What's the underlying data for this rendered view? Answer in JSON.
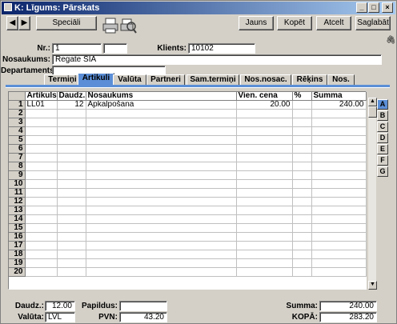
{
  "window": {
    "title": "K: Līgums: Pārskats"
  },
  "toolbar": {
    "special_label": "Speciāli",
    "new_label": "Jauns",
    "copy_label": "Kopēt",
    "cancel_label": "Atcelt",
    "save_label": "Saglabāt"
  },
  "header": {
    "nr_label": "Nr.:",
    "nr_value": "1",
    "client_label": "Klients:",
    "client_value": "10102",
    "name_label": "Nosaukums:",
    "name_value": "Regate SIA",
    "dept_label": "Departaments:",
    "dept_value": ""
  },
  "tabs": [
    {
      "label": "Termiņi"
    },
    {
      "label": "Artikuli"
    },
    {
      "label": "Valūta"
    },
    {
      "label": "Partneri"
    },
    {
      "label": "Sam.termiņi"
    },
    {
      "label": "Nos.nosac."
    },
    {
      "label": "Rēķins"
    },
    {
      "label": "Nos."
    }
  ],
  "table": {
    "columns": [
      "Artikuls",
      "Daudz.",
      "Nosaukums",
      "Vien. cena",
      "%",
      "Summa"
    ],
    "row_numbers": [
      "1",
      "2",
      "3",
      "4",
      "5",
      "6",
      "7",
      "8",
      "9",
      "10",
      "11",
      "12",
      "13",
      "14",
      "15",
      "16",
      "17",
      "18",
      "19",
      "20"
    ],
    "rows": [
      {
        "artikuls": "LL01",
        "daudz": "12",
        "nosaukums": "Apkalpošana",
        "vien_cena": "20.00",
        "pct": "",
        "summa": "240.00"
      }
    ]
  },
  "side_tabs": [
    "A",
    "B",
    "C",
    "D",
    "E",
    "F",
    "G"
  ],
  "footer": {
    "qty_label": "Daudz.:",
    "qty_value": "12.00",
    "currency_label": "Valūta:",
    "currency_value": "LVL",
    "extra_label": "Papildus:",
    "extra_value": "",
    "vat_label": "PVN:",
    "vat_value": "43.20",
    "sum_label": "Summa:",
    "sum_value": "240.00",
    "total_label": "KOPĀ:",
    "total_value": "283.20"
  }
}
